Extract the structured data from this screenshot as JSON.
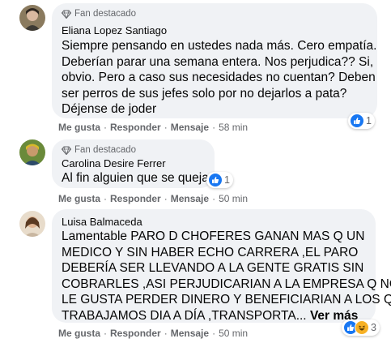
{
  "badge_label": "Fan destacado",
  "comments": [
    {
      "author": "Eliana Lopez Santiago",
      "lines": [
        "Siempre pensando en ustedes nada más. Cero empatía.",
        "Deberían parar una semana entera. Nos perjudica?? Si,",
        "obvio. Pero a caso sus necesidades no cuentan? Deben",
        "ser perros de sus jefes solo por no dejarlos a pata?",
        "Déjense de joder"
      ],
      "actions": {
        "like": "Me gusta",
        "reply": "Responder",
        "message": "Mensaje",
        "time": "58 min"
      },
      "reactions": {
        "icons": [
          "like-icon"
        ],
        "count": "1"
      }
    },
    {
      "author": "Carolina Desire Ferrer",
      "lines": [
        "Al fin alguien que se queja."
      ],
      "actions": {
        "like": "Me gusta",
        "reply": "Responder",
        "message": "Mensaje",
        "time": "50 min"
      },
      "reactions": {
        "icons": [
          "like-icon"
        ],
        "count": "1"
      }
    },
    {
      "author": "Luisa Balmaceda",
      "lines": [
        "Lamentable PARO D CHOFERES GANAN MAS Q UN",
        "MEDICO Y SIN HABER ECHO CARRERA ,EL PARO",
        "DEBERÍA SER LLEVANDO A LA GENTE GRATIS SIN",
        "COBRARLES ,ASI PERJUDICARIAN A LA EMPRESA Q NO",
        "LE GUSTA PERDER DINERO Y BENEFICIARIAN A LOS Q",
        "TRABAJAMOS DIA A DÍA ,TRANSPORTA..."
      ],
      "see_more": "Ver más",
      "actions": {
        "like": "Me gusta",
        "reply": "Responder",
        "message": "Mensaje",
        "time": "50 min"
      },
      "reactions": {
        "icons": [
          "like-icon",
          "haha-icon"
        ],
        "count": "3"
      }
    }
  ],
  "colors": {
    "bubble": "#f0f2f5",
    "like": "#1877f2",
    "haha": "#f7b125",
    "muted": "#65676b",
    "text": "#050505"
  }
}
